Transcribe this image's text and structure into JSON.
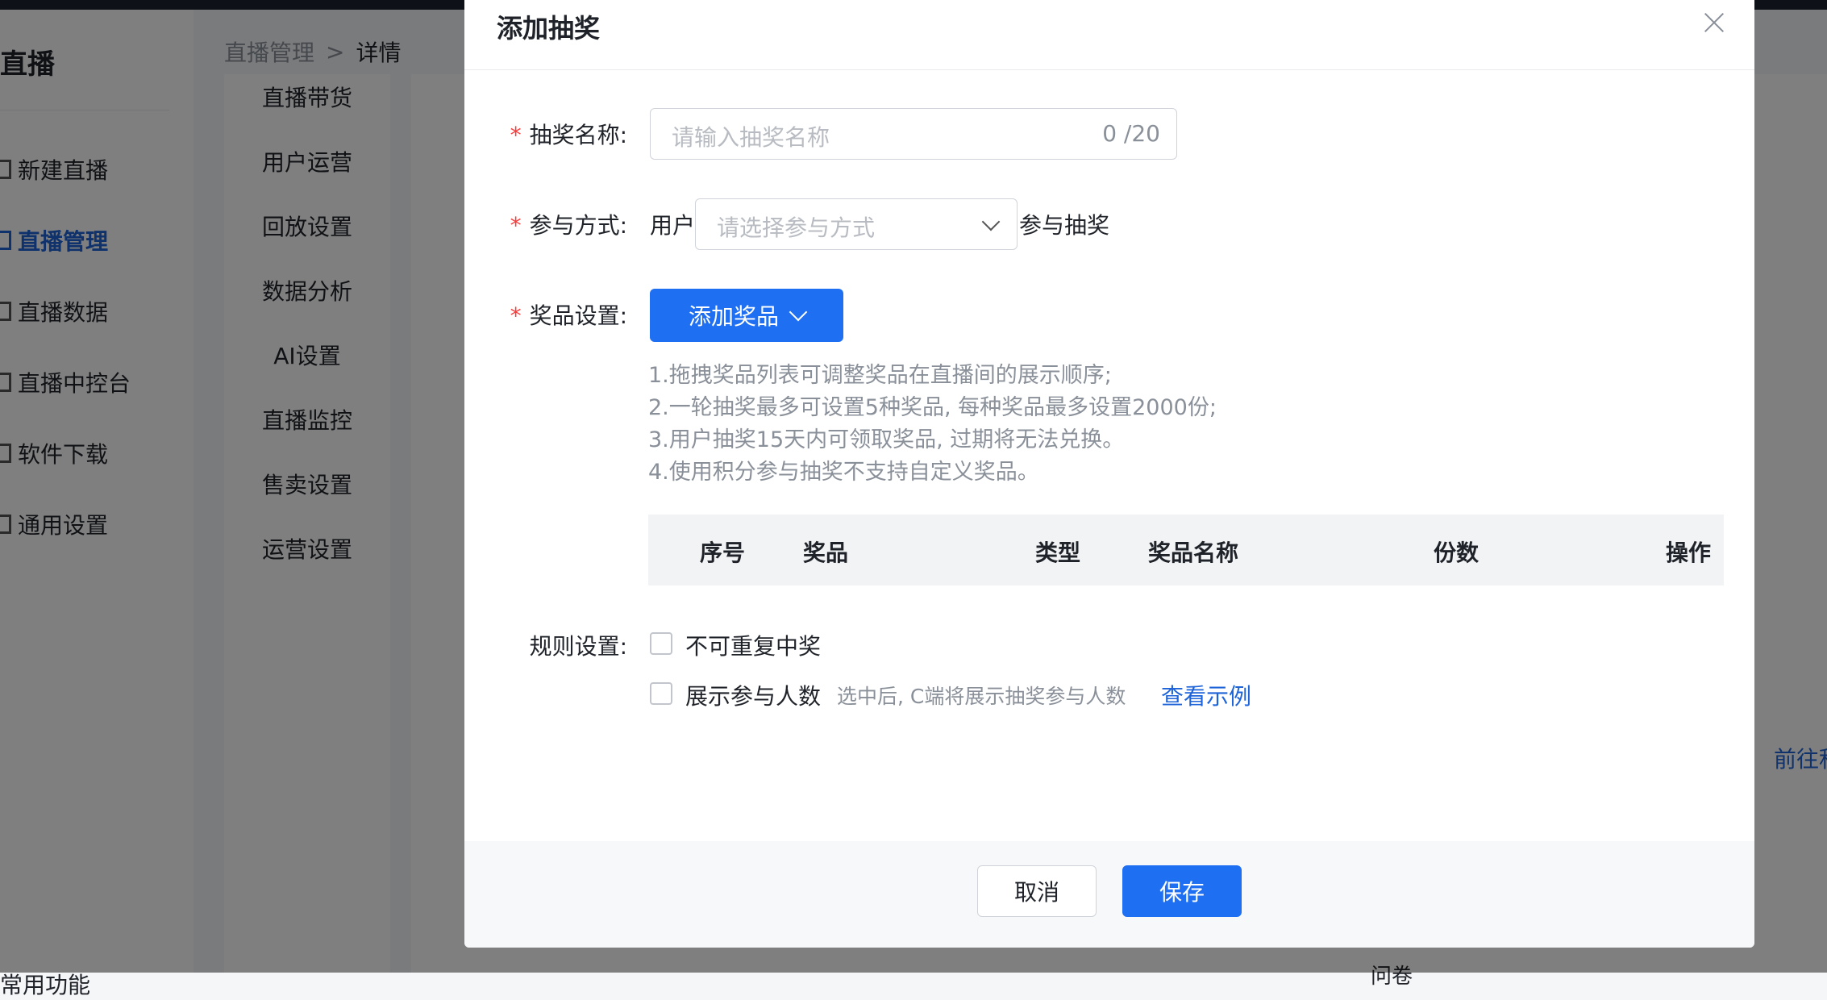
{
  "app": {
    "sidebar_title": "直播",
    "nav_items": [
      {
        "label": "新建直播",
        "active": false
      },
      {
        "label": "直播管理",
        "active": true
      },
      {
        "label": "直播数据",
        "active": false
      },
      {
        "label": "直播中控台",
        "active": false
      },
      {
        "label": "软件下载",
        "active": false
      },
      {
        "label": "通用设置",
        "active": false
      }
    ],
    "nav_bottom": "常用功能",
    "breadcrumb": {
      "parent": "直播管理",
      "separator": ">",
      "current": "详情"
    },
    "sub_nav": [
      "直播带货",
      "用户运营",
      "回放设置",
      "数据分析",
      "AI设置",
      "直播监控",
      "售卖设置",
      "运营设置"
    ],
    "goto_link": "前往积",
    "bottom_row": "问卷"
  },
  "modal": {
    "title": "添加抽奖",
    "required_mark": "*",
    "name_field": {
      "label": "抽奖名称:",
      "placeholder": "请输入抽奖名称",
      "counter": "0 /20"
    },
    "participation": {
      "label": "参与方式:",
      "prefix": "用户",
      "placeholder": "请选择参与方式",
      "suffix": "参与抽奖"
    },
    "prize": {
      "label": "奖品设置:",
      "add_button": "添加奖品",
      "tips": [
        "1.拖拽奖品列表可调整奖品在直播间的展示顺序;",
        "2.一轮抽奖最多可设置5种奖品, 每种奖品最多设置2000份;",
        "3.用户抽奖15天内可领取奖品, 过期将无法兑换。",
        "4.使用积分参与抽奖不支持自定义奖品。"
      ],
      "table_headers": [
        "序号",
        "奖品",
        "类型",
        "奖品名称",
        "份数",
        "操作"
      ]
    },
    "rules": {
      "label": "规则设置:",
      "no_repeat": {
        "label": "不可重复中奖",
        "checked": false
      },
      "show_count": {
        "label": "展示参与人数",
        "checked": false,
        "hint": "选中后, C端将展示抽奖参与人数",
        "link": "查看示例"
      }
    },
    "footer": {
      "cancel": "取消",
      "save": "保存"
    }
  },
  "colors": {
    "primary": "#1e6ff2",
    "link": "#1e64d8",
    "required": "#f53f3f"
  }
}
